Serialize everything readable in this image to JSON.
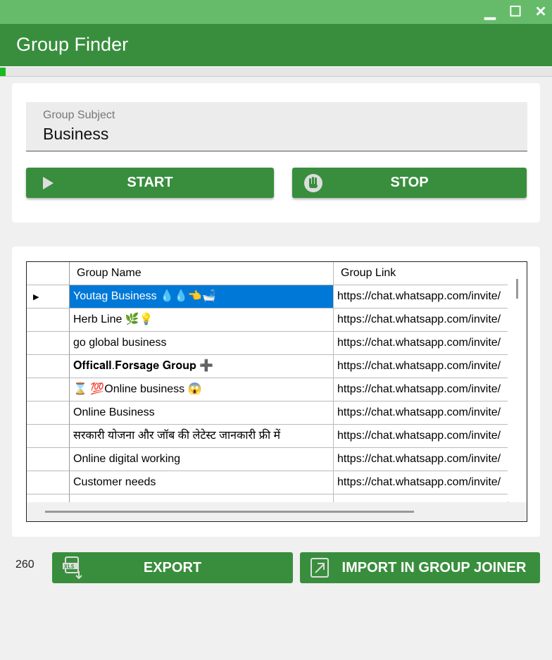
{
  "window": {
    "minimize": "▁",
    "maximize": "☐",
    "close": "✕"
  },
  "header": {
    "title": "Group Finder"
  },
  "progress": {
    "percent": 1
  },
  "search": {
    "label": "Group Subject",
    "value": "Business"
  },
  "buttons": {
    "start": "START",
    "stop": "STOP",
    "export": "EXPORT",
    "import": "IMPORT IN GROUP JOINER"
  },
  "count": "260",
  "table": {
    "columns": [
      "Group Name",
      "Group Link"
    ],
    "rows": [
      {
        "name": "Youtag Business 💧💧👈🛁",
        "link": "https://chat.whatsapp.com/invite/"
      },
      {
        "name": "Herb Line 🌿💡",
        "link": "https://chat.whatsapp.com/invite/"
      },
      {
        "name": "go global business",
        "link": "https://chat.whatsapp.com/invite/"
      },
      {
        "name": "𝐎𝐟𝐟𝐢𝐜𝐚𝐥𝐥.𝐅𝐨𝐫𝐬𝐚𝐠𝐞 𝐆𝐫𝐨𝐮𝐩 ➕",
        "link": "https://chat.whatsapp.com/invite/"
      },
      {
        "name": "⌛ 💯Online business 😱",
        "link": "https://chat.whatsapp.com/invite/"
      },
      {
        "name": "Online Business",
        "link": "https://chat.whatsapp.com/invite/"
      },
      {
        "name": "सरकारी योजना और जॉब की लेटेस्ट जानकारी फ्री में",
        "link": "https://chat.whatsapp.com/invite/"
      },
      {
        "name": "Online digital working",
        "link": "https://chat.whatsapp.com/invite/"
      },
      {
        "name": "Customer needs",
        "link": "https://chat.whatsapp.com/invite/"
      },
      {
        "name": "",
        "link": ""
      }
    ]
  }
}
